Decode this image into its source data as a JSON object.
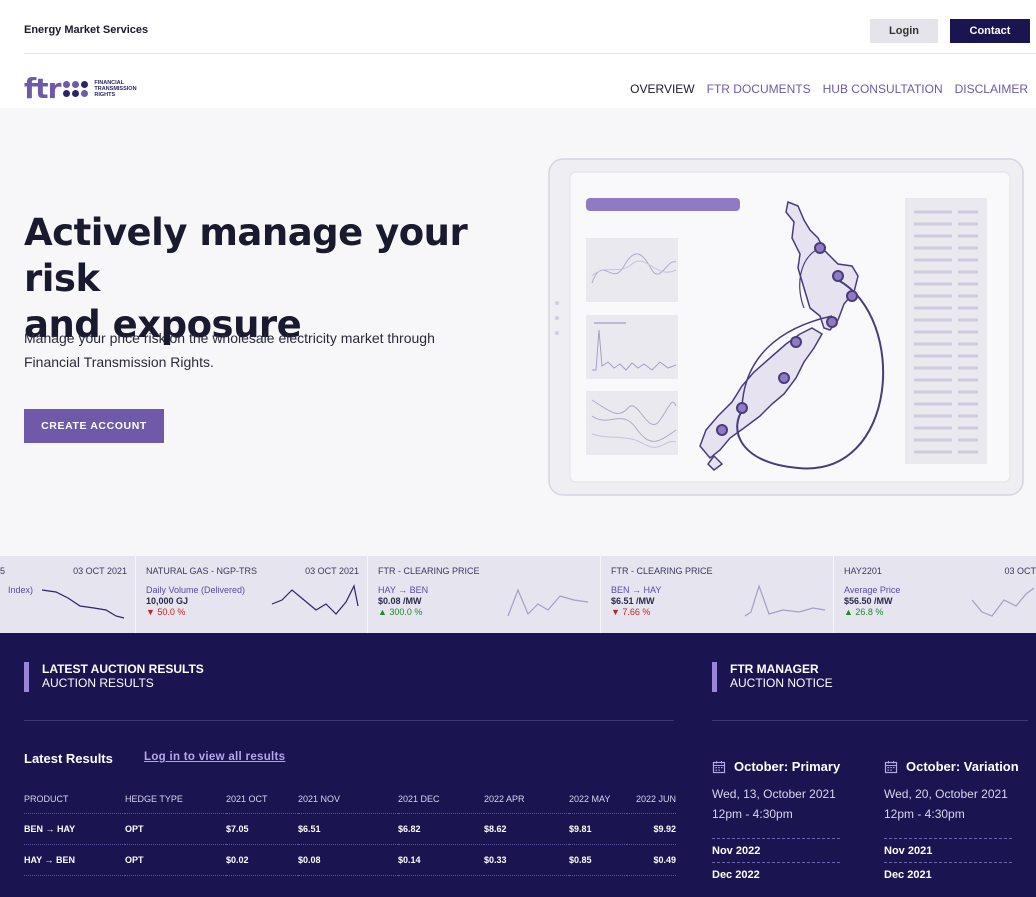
{
  "topbar": {
    "org_name": "Energy Market Services",
    "login_label": "Login",
    "contact_label": "Contact"
  },
  "logo": {
    "mark": "ftr",
    "text_lines": [
      "FINANCIAL",
      "TRANSMISSION",
      "RIGHTS"
    ]
  },
  "nav": {
    "items": [
      "OVERVIEW",
      "FTR DOCUMENTS",
      "HUB CONSULTATION",
      "DISCLAIMER"
    ],
    "active_index": 0
  },
  "hero": {
    "title_line1": "Actively manage your risk",
    "title_line2": "and exposure",
    "subtitle_line1": "Manage your price risk on the wholesale electricity market through",
    "subtitle_line2": "Financial Transmission Rights.",
    "cta_label": "CREATE ACCOUNT"
  },
  "ticker": [
    {
      "name": "5",
      "date": "03 OCT 2021",
      "sub": "Index)",
      "value": "",
      "change": "",
      "direction": ""
    },
    {
      "name": "NATURAL GAS - NGP-TRS",
      "date": "03 OCT 2021",
      "sub": "Daily Volume (Delivered)",
      "value": "10,000 GJ",
      "change": "▼ 50.0 %",
      "direction": "down"
    },
    {
      "name": "FTR - CLEARING PRICE",
      "date": "",
      "sub": "HAY → BEN",
      "value": "$0.08 /MW",
      "change": "▲ 300.0 %",
      "direction": "up"
    },
    {
      "name": "FTR - CLEARING PRICE",
      "date": "",
      "sub": "BEN → HAY",
      "value": "$6.51 /MW",
      "change": "▼ 7.66 %",
      "direction": "down"
    },
    {
      "name": "HAY2201",
      "date": "03 OCT",
      "sub": "Average Price",
      "value": "$56.50 /MW",
      "change": "▲ 26.8 %",
      "direction": "up"
    }
  ],
  "latest_auction": {
    "heading": "LATEST AUCTION RESULTS",
    "subheading": "AUCTION RESULTS",
    "results_title": "Latest Results",
    "login_link": "Log in to view all results",
    "columns": [
      "PRODUCT",
      "HEDGE TYPE",
      "2021 OCT",
      "2021 NOV",
      "2021 DEC",
      "2022 APR",
      "2022 MAY",
      "2022 JUN"
    ],
    "rows": [
      [
        "BEN → HAY",
        "OPT",
        "$7.05",
        "$6.51",
        "$6.82",
        "$8.62",
        "$9.81",
        "$9.92"
      ],
      [
        "HAY → BEN",
        "OPT",
        "$0.02",
        "$0.08",
        "$0.14",
        "$0.33",
        "$0.85",
        "$0.49"
      ]
    ]
  },
  "ftr_manager": {
    "heading": "FTR MANAGER",
    "subheading": "AUCTION NOTICE",
    "notices": [
      {
        "title": "October: Primary",
        "date": "Wed, 13, October 2021",
        "time": "12pm - 4:30pm",
        "months": [
          "Nov 2022",
          "Dec 2022"
        ]
      },
      {
        "title": "October: Variation",
        "date": "Wed, 20, October 2021",
        "time": "12pm - 4:30pm",
        "months": [
          "Nov 2021",
          "Dec 2021"
        ]
      }
    ]
  },
  "colors": {
    "brand_purple": "#6e5aa8",
    "navy": "#1a1550",
    "accent_bar": "#9a86d8",
    "up": "#1a8a2a",
    "down": "#c82020"
  }
}
